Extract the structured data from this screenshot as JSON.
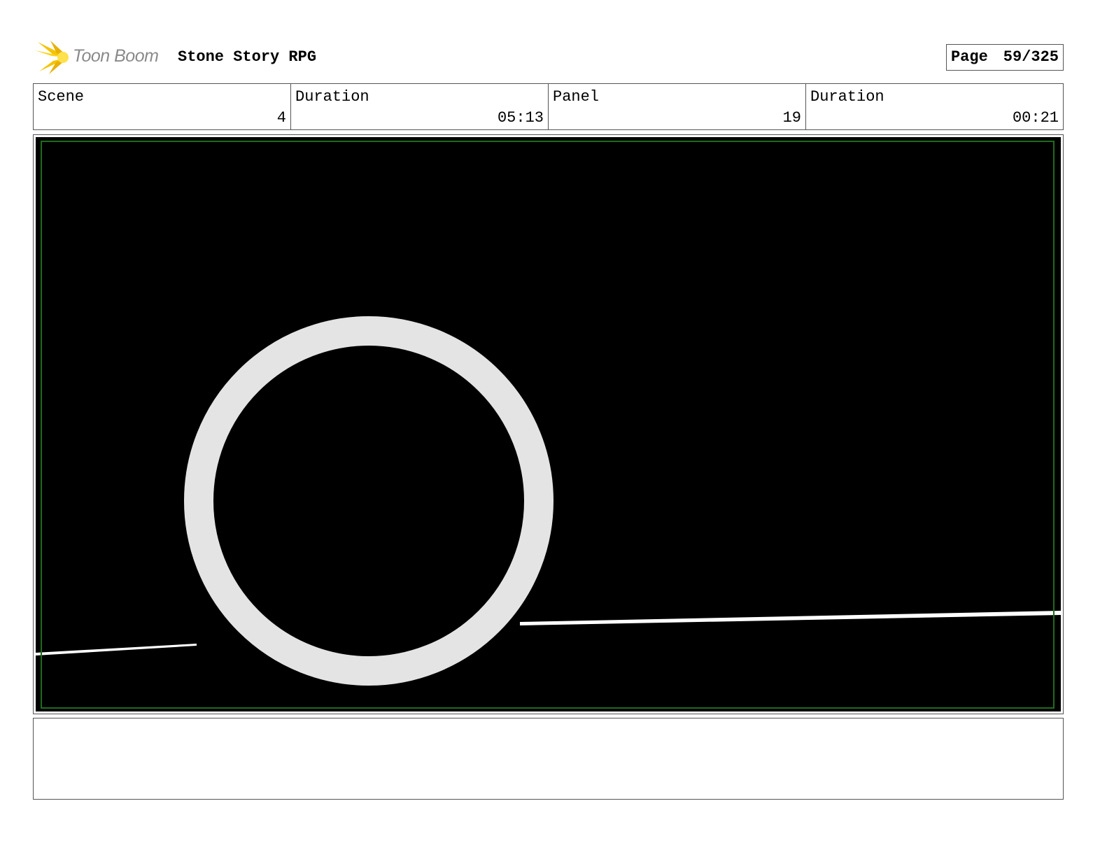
{
  "header": {
    "brand": "Toon Boom",
    "project_title": "Stone Story RPG",
    "page_label": "Page",
    "page_number": "59/325"
  },
  "info": {
    "scene_label": "Scene",
    "scene_value": "4",
    "scene_duration_label": "Duration",
    "scene_duration_value": "05:13",
    "panel_label": "Panel",
    "panel_value": "19",
    "panel_duration_label": "Duration",
    "panel_duration_value": "00:21"
  },
  "colors": {
    "logo_yellow": "#f5c400",
    "safe_frame_green": "#1e6b1e",
    "ring_gray": "#e4e4e4",
    "background_black": "#000000"
  },
  "notes": {
    "text": ""
  }
}
